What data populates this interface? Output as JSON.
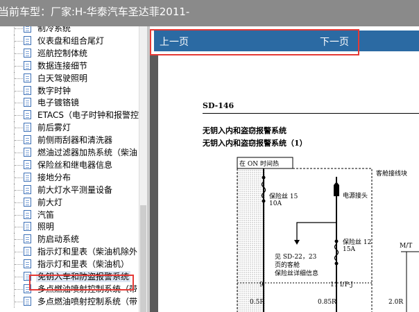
{
  "title_bar": {
    "text": "当前车型：厂家:H-华泰汽车圣达菲2011-"
  },
  "sidebar": {
    "items": [
      {
        "label": "制冷系统"
      },
      {
        "label": "仪表盘和组合尾灯"
      },
      {
        "label": "巡航控制体统"
      },
      {
        "label": "数据连接细节"
      },
      {
        "label": "白天驾驶照明"
      },
      {
        "label": "数字时钟"
      },
      {
        "label": "电子镀铬镜"
      },
      {
        "label": "ETACS（电子时钟和报警控"
      },
      {
        "label": "前后雾灯"
      },
      {
        "label": "前侧雨刮器和清洗器"
      },
      {
        "label": "燃油过滤器加热系统（柴油"
      },
      {
        "label": "保险丝和继电器信息"
      },
      {
        "label": "接地分布"
      },
      {
        "label": "前大灯水平测量设备"
      },
      {
        "label": "前大灯"
      },
      {
        "label": "汽笛"
      },
      {
        "label": "照明"
      },
      {
        "label": "防启动系统"
      },
      {
        "label": "指示灯和里表（柴油机除外"
      },
      {
        "label": "指示灯和里表（柴油机）"
      },
      {
        "label": "免钥入车和防盗报警系统",
        "selected": true
      },
      {
        "label": "多点燃油喷射控制系统（带"
      },
      {
        "label": "多点燃油喷射控制系统（带"
      }
    ]
  },
  "viewer": {
    "nav": {
      "prev": "上一页",
      "next": "下一页",
      "color": "#2b6aa3"
    },
    "page": {
      "number": "SD-146",
      "heading1": "无钥入内和盗窃报警系统",
      "heading2": "无钥入内和盗窃报警系统（1）",
      "diagram": {
        "top_label": "在 ON 时间热",
        "right_label": "客舱接线块",
        "fuse15": "保险丝 15",
        "fuse15_amp": "10A",
        "power": "电源接头",
        "fuse12": "保险丝 12",
        "fuse12_amp": "15A",
        "note1": "见 SD-22，23",
        "note2": "页的客舱",
        "note3": "保险丝详细信息",
        "mt": "M/T",
        "pin9": "9",
        "pin11": "11",
        "ipj": "I/P-J",
        "wire1": "0.5R",
        "wire2": "0.85R",
        "wire3": "2.0R"
      }
    }
  },
  "colors": {
    "accent": "#2b6aa3",
    "highlight": "#e53935",
    "titlebar": "#8a8a8a"
  }
}
